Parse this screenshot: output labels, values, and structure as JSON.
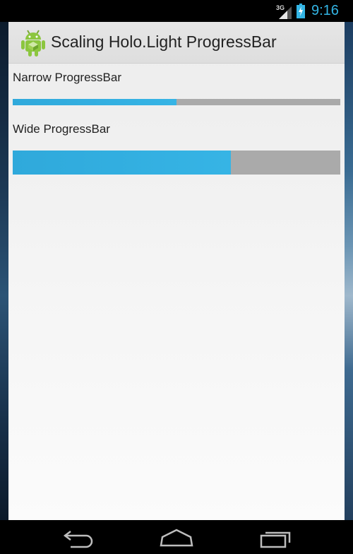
{
  "status_bar": {
    "network_type": "3G",
    "time": "9:16",
    "icons": [
      "signal-icon",
      "battery-charging-icon"
    ]
  },
  "action_bar": {
    "title": "Scaling Holo.Light ProgressBar",
    "icon": "android-app-icon"
  },
  "progress_bars": {
    "narrow": {
      "label": "Narrow ProgressBar",
      "progress_percent": 50
    },
    "wide": {
      "label": "Wide ProgressBar",
      "progress_percent": 66.5
    }
  },
  "colors": {
    "accent": "#33b5e5",
    "track": "#aaaaaa",
    "background": "#f2f2f2",
    "action_bar": "#e2e2e2"
  },
  "nav_bar": {
    "buttons": [
      "back-icon",
      "home-icon",
      "recent-apps-icon"
    ]
  }
}
